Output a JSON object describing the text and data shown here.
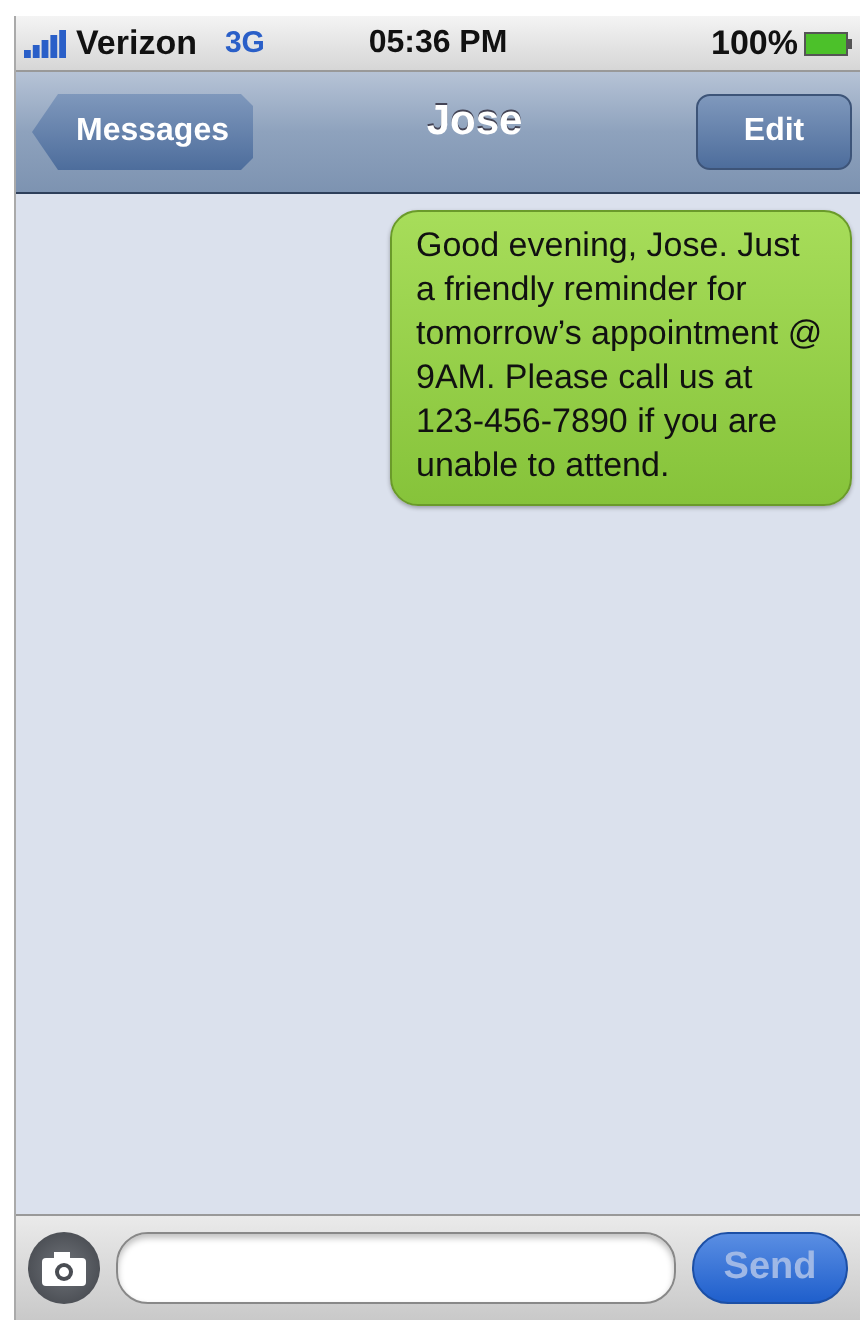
{
  "status_bar": {
    "carrier": "Verizon",
    "network": "3G",
    "time": "05:36 PM",
    "battery": "100%"
  },
  "nav_bar": {
    "back": "Messages",
    "title": "Jose",
    "action": "Edit"
  },
  "messages": [
    {
      "kind": "sent",
      "text": "Good evening, Jose. Just a friendly reminder for tomorrow’s appointment @ 9AM. Please call us at 123-456-7890 if you are unable to attend."
    }
  ],
  "compose": {
    "send": {
      "label": "Send",
      "disabled": true
    }
  }
}
